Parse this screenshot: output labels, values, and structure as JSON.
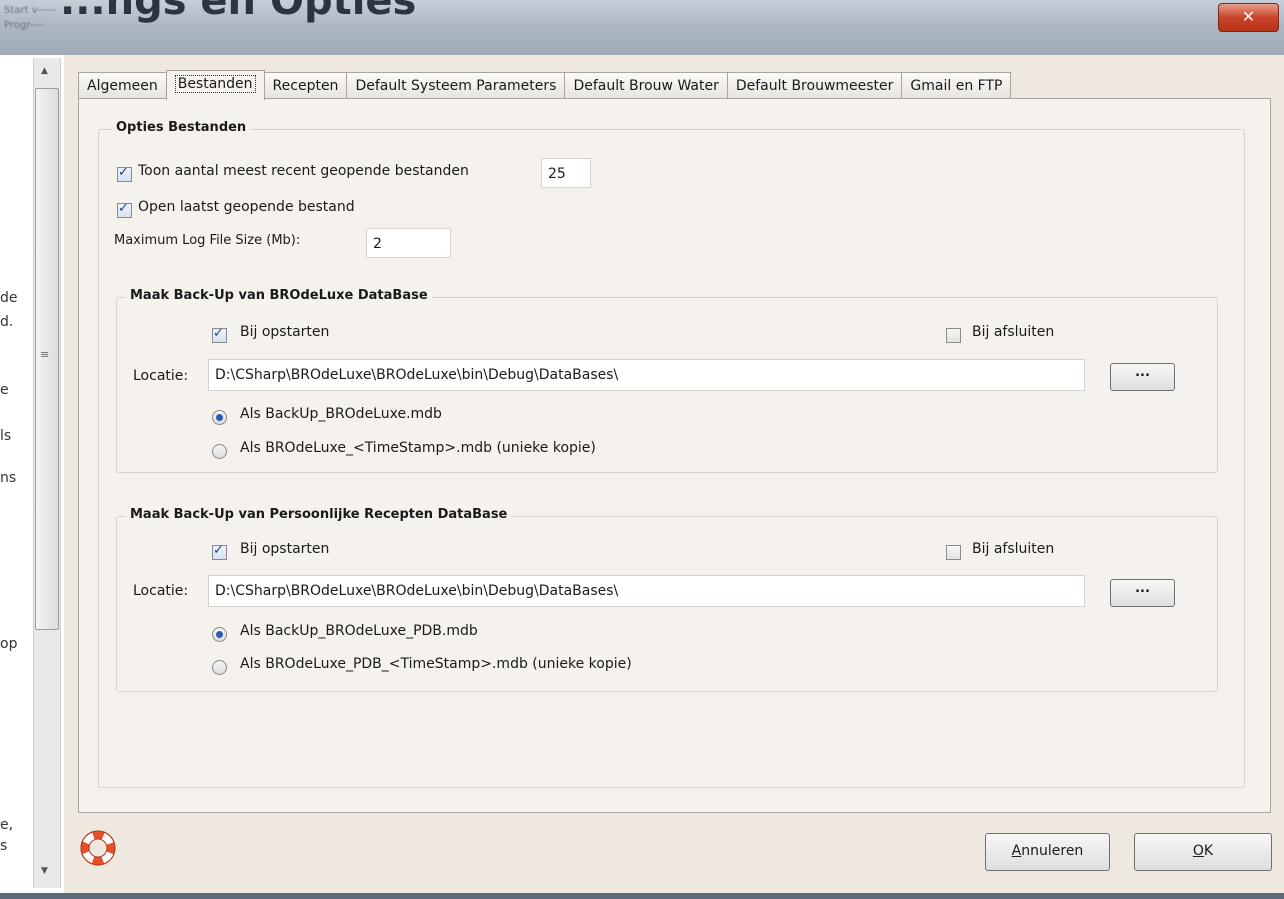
{
  "window": {
    "title": "...ngs en Opties",
    "title_small_1": "Start v-----",
    "title_small_2": "Progr----",
    "close_label": "✕"
  },
  "left_fragments": [
    "de",
    "d.",
    "e",
    "ls",
    "ns",
    "op",
    "e,",
    "s"
  ],
  "tabs": [
    {
      "label": "Algemeen"
    },
    {
      "label": "Bestanden"
    },
    {
      "label": "Recepten"
    },
    {
      "label": "Default Systeem Parameters"
    },
    {
      "label": "Default Brouw Water"
    },
    {
      "label": "Default Brouwmeester"
    },
    {
      "label": "Gmail en FTP"
    }
  ],
  "options": {
    "legend": "Opties Bestanden",
    "recent_label": "Toon aantal meest recent geopende bestanden",
    "recent_checked": true,
    "recent_value": "25",
    "open_last_label": "Open laatst geopende bestand",
    "open_last_checked": true,
    "logsize_label": "Maximum Log File Size (Mb):",
    "logsize_value": "2"
  },
  "backup_db": {
    "legend": "Maak Back-Up van BROdeLuxe DataBase",
    "startup_label": "Bij opstarten",
    "startup_checked": true,
    "close_label": "Bij afsluiten",
    "close_checked": false,
    "location_label": "Locatie:",
    "location_value": "D:\\CSharp\\BROdeLuxe\\BROdeLuxe\\bin\\Debug\\DataBases\\",
    "browse_label": "...",
    "radio1_label": "Als BackUp_BROdeLuxe.mdb",
    "radio2_label": "Als BROdeLuxe_<TimeStamp>.mdb (unieke kopie)",
    "selected": 1
  },
  "backup_pdb": {
    "legend": "Maak Back-Up van Persoonlijke Recepten DataBase",
    "startup_label": "Bij opstarten",
    "startup_checked": true,
    "close_label": "Bij afsluiten",
    "close_checked": false,
    "location_label": "Locatie:",
    "location_value": "D:\\CSharp\\BROdeLuxe\\BROdeLuxe\\bin\\Debug\\DataBases\\",
    "browse_label": "...",
    "radio1_label": "Als BackUp_BROdeLuxe_PDB.mdb",
    "radio2_label": "Als BROdeLuxe_PDB_<TimeStamp>.mdb (unieke kopie)",
    "selected": 1
  },
  "buttons": {
    "cancel_prefix": "A",
    "cancel_rest": "nnuleren",
    "ok_prefix": "O",
    "ok_rest": "K"
  }
}
